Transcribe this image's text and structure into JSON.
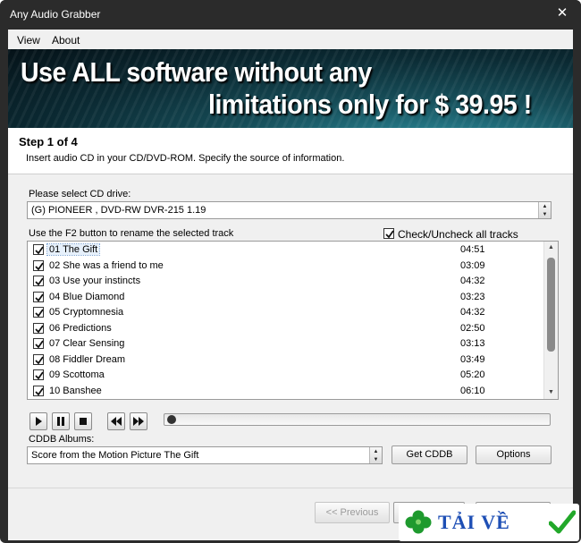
{
  "window": {
    "title": "Any Audio Grabber"
  },
  "menu": {
    "view": "View",
    "about": "About"
  },
  "banner": {
    "line1": "Use ALL software without any",
    "line2": "limitations only for $ 39.95 !"
  },
  "step": {
    "title": "Step 1 of 4",
    "description": "Insert audio CD in your CD/DVD-ROM. Specify the source of information."
  },
  "drive": {
    "label": "Please select CD drive:",
    "selected": "(G) PIONEER , DVD-RW  DVR-215   1.19"
  },
  "tracks_hint": "Use the F2 button to rename the selected track",
  "check_all_label": "Check/Uncheck all tracks",
  "tracks": [
    {
      "name": "01 The Gift",
      "duration": "04:51",
      "checked": true
    },
    {
      "name": "02 She was a friend to me",
      "duration": "03:09",
      "checked": true
    },
    {
      "name": "03 Use your instincts",
      "duration": "04:32",
      "checked": true
    },
    {
      "name": "04 Blue Diamond",
      "duration": "03:23",
      "checked": true
    },
    {
      "name": "05 Cryptomnesia",
      "duration": "04:32",
      "checked": true
    },
    {
      "name": "06 Predictions",
      "duration": "02:50",
      "checked": true
    },
    {
      "name": "07 Clear Sensing",
      "duration": "03:13",
      "checked": true
    },
    {
      "name": "08 Fiddler Dream",
      "duration": "03:49",
      "checked": true
    },
    {
      "name": "09 Scottoma",
      "duration": "05:20",
      "checked": true
    },
    {
      "name": "10 Banshee",
      "duration": "06:10",
      "checked": true
    }
  ],
  "cddb": {
    "label": "CDDB Albums:",
    "selected": "Score from the Motion Picture The Gift",
    "get_button": "Get CDDB",
    "options_button": "Options"
  },
  "footer": {
    "previous_button": "<< Previous"
  },
  "watermark": {
    "text": "TẢI VỀ"
  },
  "colors": {
    "titlebar": "#2b2b2b",
    "client": "#f0f0f0",
    "watermark_text": "#1e4fb5"
  }
}
